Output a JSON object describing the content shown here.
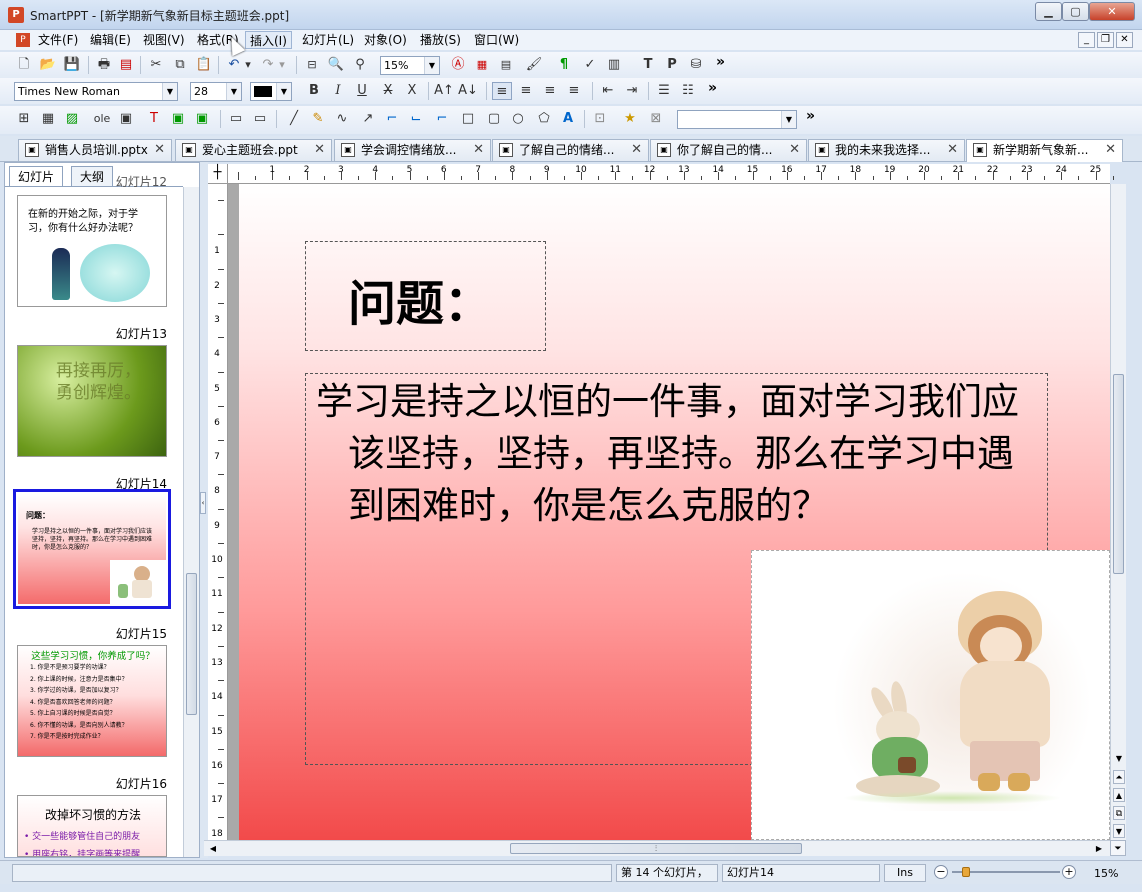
{
  "window": {
    "app_name": "SmartPPT",
    "title": "SmartPPT - [新学期新气象新目标主题班会.ppt]"
  },
  "menu": [
    "文件(F)",
    "编辑(E)",
    "视图(V)",
    "格式(R)",
    "插入(I)",
    "幻灯片(L)",
    "对象(O)",
    "播放(S)",
    "窗口(W)"
  ],
  "toolbar": {
    "zoom": "15%",
    "font_name": "Times New Roman",
    "font_size": "28",
    "more": "»"
  },
  "tabs": [
    "销售人员培训.pptx",
    "爱心主题班会.ppt",
    "学会调控情绪放...",
    "了解自己的情绪...",
    "你了解自己的情...",
    "我的未来我选择...",
    "新学期新气象新..."
  ],
  "panel": {
    "tab_slides": "幻灯片",
    "tab_outline": "大纲"
  },
  "thumbnails": [
    {
      "label": "幻灯片12",
      "text": "在新的开始之际，对于学习，你有什么好办法呢？"
    },
    {
      "label": "幻灯片13",
      "text": "再接再厉，勇创辉煌。"
    },
    {
      "label": "幻灯片14",
      "title": "问题：",
      "text": "学习是持之以恒的一件事，面对学习我们应该坚持，坚持，再坚持。那么在学习中遇到困难时，你是怎么克服的？"
    },
    {
      "label": "幻灯片15",
      "title": "这些学习习惯，你养成了吗？",
      "items": [
        "1. 你是不是预习要学的功课？",
        "2. 你上课的时候，注意力是否集中？",
        "3. 你学过的功课，是否加以复习？",
        "4. 你是否喜欢回答老师的问题？",
        "5. 你上自习课的时候是否自觉？",
        "6. 你不懂的功课，是否向别人请教？",
        "7. 你是不是按时完成作业？"
      ]
    },
    {
      "label": "幻灯片16",
      "title": "改掉坏习惯的方法",
      "items": [
        "• 交一些能够管住自己的朋友",
        "• 用座右铭，挂字画等来提醒"
      ]
    }
  ],
  "slide": {
    "heading": "问题：",
    "body": "学习是持之以恒的一件事，面对学习我们应该坚持，坚持，再坚持。那么在学习中遇到困难时，你是怎么克服的？"
  },
  "ruler": {
    "h": [
      "1",
      "2",
      "3",
      "4",
      "5",
      "6",
      "7",
      "8",
      "9",
      "10",
      "11",
      "12",
      "13",
      "14",
      "15",
      "16",
      "17",
      "18",
      "19",
      "20",
      "21",
      "22",
      "23",
      "24",
      "25"
    ],
    "v": [
      "1",
      "2",
      "3",
      "4",
      "5",
      "6",
      "7",
      "8",
      "9",
      "10",
      "11",
      "12",
      "13",
      "14",
      "15",
      "16",
      "17",
      "18"
    ]
  },
  "status": {
    "slide_of": "第 14 个幻灯片，",
    "slide_name": "幻灯片14",
    "mode": "Ins",
    "zoom": "15%"
  },
  "colors": {
    "selection_border": "#1a1ae0",
    "slide_gradient_top": "#ffffff",
    "slide_gradient_bottom": "#f24a4a"
  }
}
